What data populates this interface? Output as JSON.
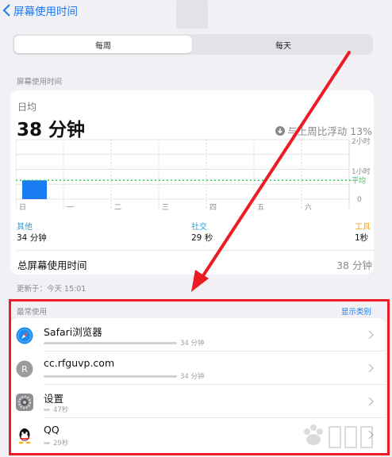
{
  "nav": {
    "back_label": "屏幕使用时间"
  },
  "segments": {
    "weekly": "每周",
    "daily": "每天"
  },
  "screen_time_section": "屏幕使用时间",
  "summary": {
    "daily_avg_label": "日均",
    "daily_avg_value": "38 分钟",
    "compare_text": "与上周比浮动 13%"
  },
  "chart": {
    "y_labels": [
      "2小时",
      "1小时",
      "0"
    ],
    "avg_label": "平均",
    "days": [
      "日",
      "一",
      "二",
      "三",
      "四",
      "五",
      "六"
    ]
  },
  "chart_data": {
    "type": "bar",
    "categories": [
      "日",
      "一",
      "二",
      "三",
      "四",
      "五",
      "六"
    ],
    "values": [
      38,
      0,
      0,
      0,
      0,
      0,
      0
    ],
    "average": 38,
    "ylim": [
      0,
      120
    ],
    "yticks": [
      "0",
      "1小时",
      "2小时"
    ]
  },
  "categories": [
    {
      "name": "其他",
      "value": "34 分钟",
      "color": "#2aa0d8"
    },
    {
      "name": "社交",
      "value": "29 秒",
      "color": "#2aa0d8"
    },
    {
      "name": "工具",
      "value": "1秒",
      "color": "#f5a623"
    }
  ],
  "total": {
    "label": "总屏幕使用时间",
    "value": "38 分钟"
  },
  "updated": "更新于：今天 15:01",
  "most_used": {
    "label": "最常使用",
    "show_categories": "显示类别",
    "apps": [
      {
        "name": "Safari浏览器",
        "usage": "34 分钟",
        "level": 0.6,
        "icon": "safari-icon"
      },
      {
        "name": "cc.rfguvp.com",
        "usage": "34 分钟",
        "level": 0.6,
        "icon": "website-icon"
      },
      {
        "name": "设置",
        "usage": "47秒",
        "level": 0.02,
        "icon": "settings-icon"
      },
      {
        "name": "QQ",
        "usage": "29秒",
        "level": 0.01,
        "icon": "qq-icon"
      }
    ]
  },
  "colors": {
    "accent": "#1a7cf3",
    "bar": "#1a7cf3",
    "average": "#34c759",
    "annotation": "#ec1c24"
  }
}
